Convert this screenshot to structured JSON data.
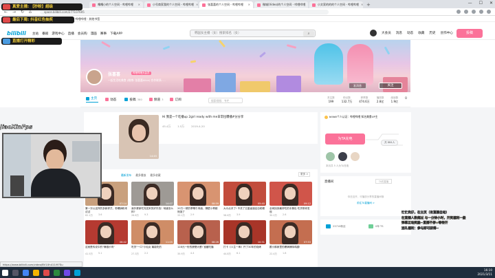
{
  "browser": {
    "tabs": [
      {
        "label": "嘎嘎小的个人空间 - 哔哩哔哩",
        "active": false
      },
      {
        "label": "小号商家我的个人空间 - 哔哩哔哩",
        "active": false
      },
      {
        "label": "张喜喜的个人空间 - 哔哩哔哩",
        "active": true
      },
      {
        "label": "微城(Video)的个人空间 - 哔哩哔哩",
        "active": false
      },
      {
        "label": "小文家的的的个人空间 - 哔哩哔哩",
        "active": false
      }
    ],
    "new_tab": "+",
    "url": "space.bilibili.com/277107605",
    "bookmark_text": "应用 · 书签 · 百度一下 · 哔哩哔哩 · 其他书签"
  },
  "bili_nav": {
    "logo": "bilibili",
    "items": [
      "主站",
      "番剧",
      "游戏中心",
      "直播",
      "会员购",
      "漫画",
      "赛事",
      "下载APP"
    ],
    "search_placeholder": "韩国女主播（女）搜索排名（女）",
    "search_icon": "search-icon",
    "right_items": [
      "大会员",
      "消息",
      "动态",
      "收藏",
      "历史",
      "创作中心"
    ],
    "upload": "投稿"
  },
  "banner": {
    "name": "张喜喜",
    "badge": "哔哩哔哩大会员",
    "signature": "一起生活吃美食 (微博: 张喜喜Alice) 合作联系: ...",
    "message_button": "发消息",
    "follow_button": "关注"
  },
  "space_tabs": [
    {
      "label": "主页",
      "count": "",
      "active": true
    },
    {
      "label": "动态",
      "count": "",
      "active": false
    },
    {
      "label": "投稿",
      "count": "380",
      "active": false
    },
    {
      "label": "频道",
      "count": "3",
      "active": false
    },
    {
      "label": "订阅",
      "count": "",
      "active": false
    }
  ],
  "space_search_placeholder": "搜索视频、专栏",
  "stats": [
    {
      "label": "关注数",
      "value": "199"
    },
    {
      "label": "粉丝数",
      "value": "132.7万"
    },
    {
      "label": "获赞数",
      "value": "474.6万"
    },
    {
      "label": "播放数",
      "value": "2.8亿"
    },
    {
      "label": "阅读数",
      "value": "1.9亿"
    },
    {
      "label": "",
      "value": "0"
    }
  ],
  "representative": {
    "title": "Hi 我是一个吃播up 2girl ready with me日常拉曝播#分分享",
    "duration": "14:45",
    "views": "45.4万",
    "danmaku": "1.5万",
    "date": "2019-4-20"
  },
  "videos": {
    "tabs": [
      "最新发布",
      "最多播放",
      "最多收藏"
    ],
    "more": "更多 >",
    "items": [
      {
        "title": "第一次以这样的多款样式，带螺蛳粉来试试",
        "views": "62.1万",
        "danmaku": "3.6",
        "duration": "07:14",
        "color": "#c9a07d"
      },
      {
        "title": "我外婆家吃完送来的好东西！味道怎么样?",
        "views": "26.8万",
        "danmaku": "9.3",
        "duration": "14:07",
        "color": "#9e9a95"
      },
      {
        "title": "20万一顿的草莓牛肉面，隔壁小哥都馋哭了",
        "views": "33.1万",
        "danmaku": "2.9",
        "duration": "08:59",
        "color": "#d89471"
      },
      {
        "title": "大众点评了! 不洗了五星级酒店自助餐",
        "views": "58.6万",
        "danmaku": "3.9",
        "duration": "05:40",
        "color": "#c24c3c"
      },
      {
        "title": "全网找到最好吃的手撕包 吃货带你发现",
        "views": "30.2万",
        "danmaku": "2.6",
        "duration": "09:12",
        "color": "#d0554a"
      },
      {
        "title": "这就是传说中的\"辣椒炒肉\"",
        "views": "41.5万",
        "danmaku": "5.1",
        "duration": "06:42",
        "color": "#b53a31"
      },
      {
        "title": "吃货\"一口\"小仙女 最能吃的",
        "views": "27.3万",
        "danmaku": "2.2",
        "duration": "11:05",
        "color": "#cf8d67"
      },
      {
        "title": "128元一份的螃蟹大餐! 宝藏吃播",
        "views": "35.9万",
        "danmaku": "4.4",
        "duration": "08:26",
        "color": "#b8614d"
      },
      {
        "title": "打卡《人生一串》开了30年的烧烤",
        "views": "44.8万",
        "danmaku": "6.1",
        "duration": "10:31",
        "color": "#a83528"
      },
      {
        "title": "跟小鹅家里的爆满辣味鸡腿!",
        "views": "22.4万",
        "danmaku": "1.8",
        "duration": "07:53",
        "color": "#c46e50"
      }
    ]
  },
  "right": {
    "auth": "bilibili个人认证：哔哩哔哩 知名美食UP主",
    "charge_button": "为TA充电",
    "charge_pill": "共 884人",
    "charge_text": "本月共 5 人为TA充电",
    "live_title": "直播间",
    "live_input": "TA的直播",
    "live_empty": "你还没开，可播放分享的直播间哦",
    "live_link": "前往TA直播间 >",
    "bottom_items": [
      "23710粉丝",
      "0年·TS"
    ]
  },
  "overlay": {
    "bar1": "真爱主播: 【秒粉】超级",
    "bar2": "最后下周: 抖音红色抽奖",
    "bar3": "直播打开精彩",
    "streamer": "JiaoXinFps",
    "ticker": [
      "忙忙兜仔，在主页（有直播自动）",
      "在直播人数超过 与一分钟小时，开奖福利一般",
      "弹幕互动奖励~直播不停+等待开",
      "送礼福利：参与即可获得~"
    ]
  },
  "status_url": "https://www.bilibili.com/video/BV1Xh411i97Su",
  "clock": {
    "time": "16:10",
    "date": "2021/3/11"
  },
  "colors": {
    "bili_pink": "#fb7299",
    "bili_blue": "#00a1d6"
  }
}
